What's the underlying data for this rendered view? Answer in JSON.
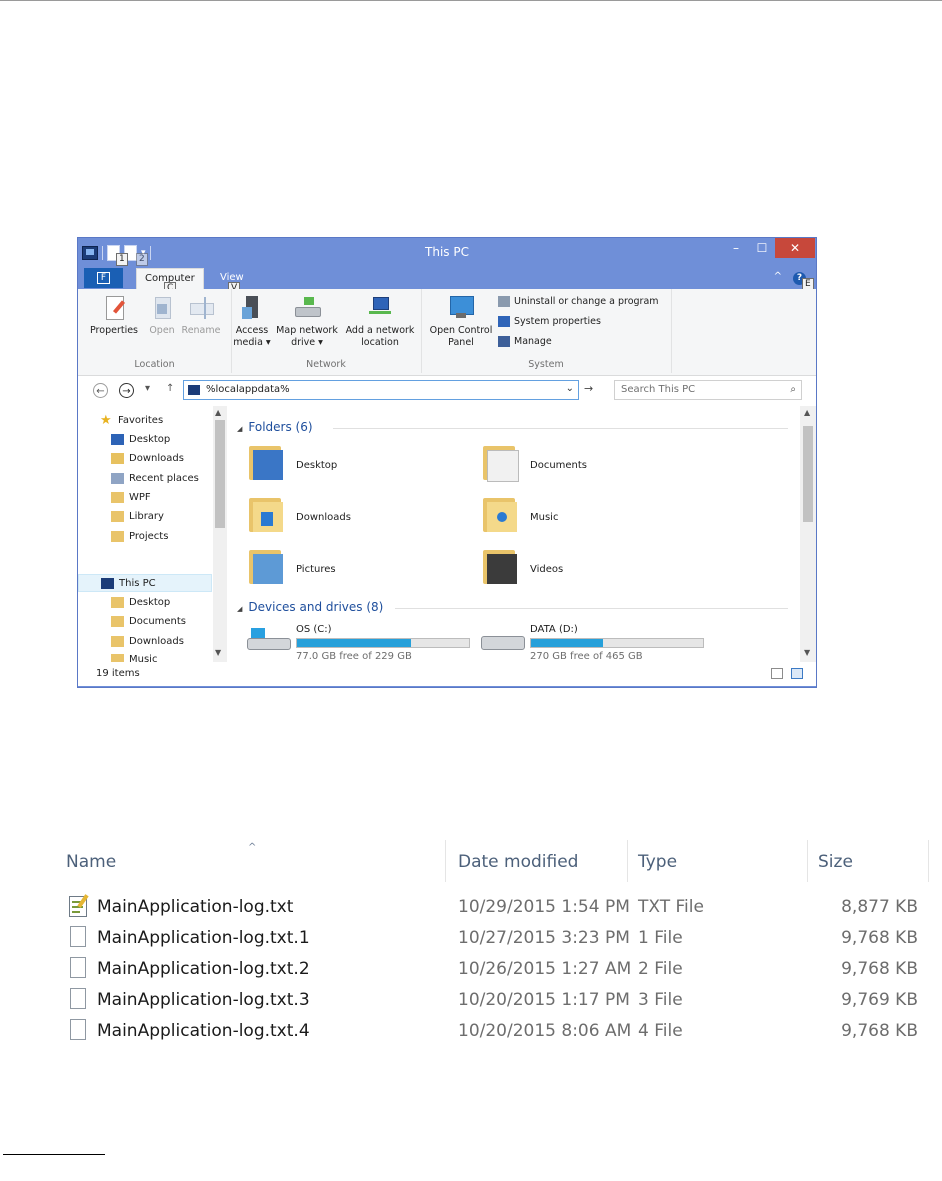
{
  "window": {
    "title": "This PC",
    "min_label": "–",
    "max_label": "☐",
    "close_label": "✕",
    "qat_keytips": [
      "1",
      "2"
    ],
    "qat_down": "▾"
  },
  "tabs": {
    "file": "F",
    "computer": "Computer",
    "computer_keytip": "C",
    "view": "View",
    "view_keytip": "V",
    "help": "?",
    "help_keytip": "E",
    "collapse": "^"
  },
  "ribbon": {
    "location": {
      "label": "Location",
      "properties": "Properties",
      "open": "Open",
      "rename": "Rename"
    },
    "network": {
      "label": "Network",
      "access_media_1": "Access",
      "access_media_2": "media ▾",
      "map_drive_1": "Map network",
      "map_drive_2": "drive ▾",
      "add_location_1": "Add a network",
      "add_location_2": "location"
    },
    "system": {
      "label": "System",
      "control_panel_1": "Open Control",
      "control_panel_2": "Panel",
      "uninstall": "Uninstall or change a program",
      "system_properties": "System properties",
      "manage": "Manage"
    }
  },
  "address": {
    "back": "←",
    "forward": "→",
    "recent": "▾",
    "up": "↑",
    "path": "%localappdata%",
    "dropdown": "⌄",
    "go": "→",
    "search_placeholder": "Search This PC",
    "search_icon": "⌕"
  },
  "nav": {
    "favorites": "Favorites",
    "desktop": "Desktop",
    "downloads": "Downloads",
    "recent": "Recent places",
    "wpf": "WPF",
    "library": "Library",
    "projects": "Projects",
    "this_pc": "This PC",
    "pc_desktop": "Desktop",
    "pc_documents": "Documents",
    "pc_downloads": "Downloads",
    "pc_music": "Music"
  },
  "content": {
    "folders_header": "Folders (6)",
    "folders": [
      "Desktop",
      "Documents",
      "Downloads",
      "Music",
      "Pictures",
      "Videos"
    ],
    "devices_header": "Devices and drives (8)",
    "drives": [
      {
        "name": "OS (C:)",
        "free": "77.0 GB free of 229 GB",
        "used_fraction": 0.66
      },
      {
        "name": "DATA (D:)",
        "free": "270 GB free of 465 GB",
        "used_fraction": 0.42
      }
    ]
  },
  "status": {
    "items": "19 items"
  },
  "filelist": {
    "headers": {
      "name": "Name",
      "date": "Date modified",
      "type": "Type",
      "size": "Size"
    },
    "sort_arrow": "^",
    "rows": [
      {
        "name": "MainApplication-log.txt",
        "date": "10/29/2015 1:54 PM",
        "type": "TXT File",
        "size": "8,877 KB",
        "icon": "text-file-icon"
      },
      {
        "name": "MainApplication-log.txt.1",
        "date": "10/27/2015 3:23 PM",
        "type": "1 File",
        "size": "9,768 KB",
        "icon": "blank-file-icon"
      },
      {
        "name": "MainApplication-log.txt.2",
        "date": "10/26/2015 1:27 AM",
        "type": "2 File",
        "size": "9,768 KB",
        "icon": "blank-file-icon"
      },
      {
        "name": "MainApplication-log.txt.3",
        "date": "10/20/2015 1:17 PM",
        "type": "3 File",
        "size": "9,769 KB",
        "icon": "blank-file-icon"
      },
      {
        "name": "MainApplication-log.txt.4",
        "date": "10/20/2015 8:06 AM",
        "type": "4 File",
        "size": "9,768 KB",
        "icon": "blank-file-icon"
      }
    ]
  }
}
